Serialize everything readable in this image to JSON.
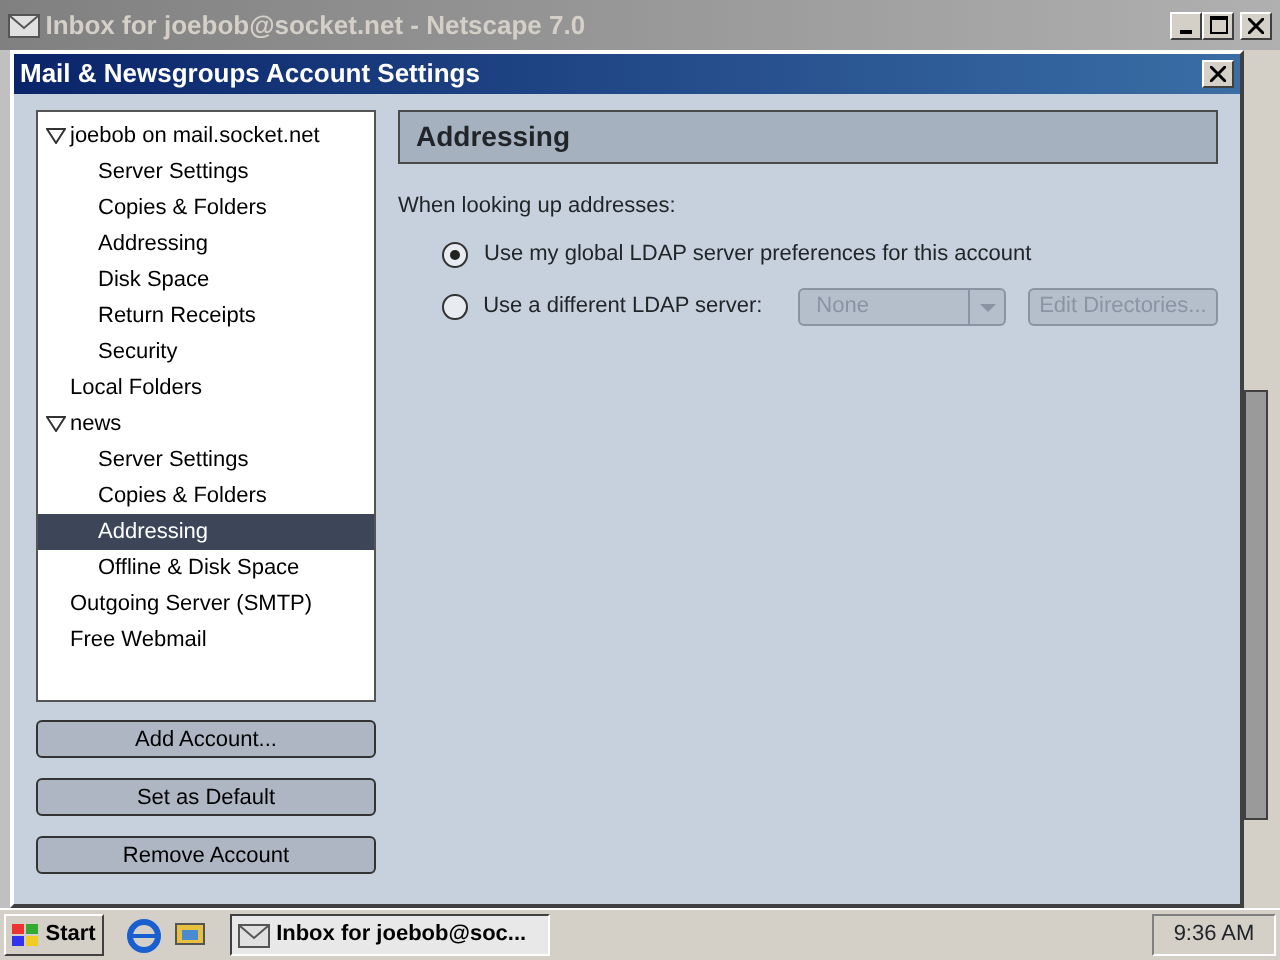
{
  "background_window": {
    "title": "Inbox for joebob@socket.net - Netscape 7.0"
  },
  "dialog": {
    "title": "Mail & Newsgroups Account Settings",
    "tree": [
      {
        "label": "joebob on mail.socket.net",
        "selected": false,
        "expanded": true,
        "children": [
          {
            "label": "Server Settings",
            "selected": false
          },
          {
            "label": "Copies & Folders",
            "selected": false
          },
          {
            "label": "Addressing",
            "selected": false
          },
          {
            "label": "Disk Space",
            "selected": false
          },
          {
            "label": "Return Receipts",
            "selected": false
          },
          {
            "label": "Security",
            "selected": false
          }
        ]
      },
      {
        "label": "Local Folders",
        "selected": false
      },
      {
        "label": "news",
        "selected": false,
        "expanded": true,
        "children": [
          {
            "label": "Server Settings",
            "selected": false
          },
          {
            "label": "Copies & Folders",
            "selected": false
          },
          {
            "label": "Addressing",
            "selected": true
          },
          {
            "label": "Offline & Disk Space",
            "selected": false
          }
        ]
      },
      {
        "label": "Outgoing Server (SMTP)",
        "selected": false
      },
      {
        "label": "Free Webmail",
        "selected": false
      }
    ],
    "account_buttons": [
      "Add Account...",
      "Set as Default",
      "Remove Account"
    ],
    "panel": {
      "heading": "Addressing",
      "prompt": "When looking up addresses:",
      "options": [
        {
          "label": "Use my global LDAP server preferences for this account",
          "selected": true
        },
        {
          "label": "Use a different LDAP server:",
          "selected": false
        }
      ],
      "server_select": {
        "value": "None",
        "disabled": true
      },
      "edit_button": {
        "label": "Edit Directories...",
        "disabled": true
      }
    }
  },
  "taskbar": {
    "start": "Start",
    "task": "Inbox for joebob@soc...",
    "clock": "9:36 AM"
  }
}
